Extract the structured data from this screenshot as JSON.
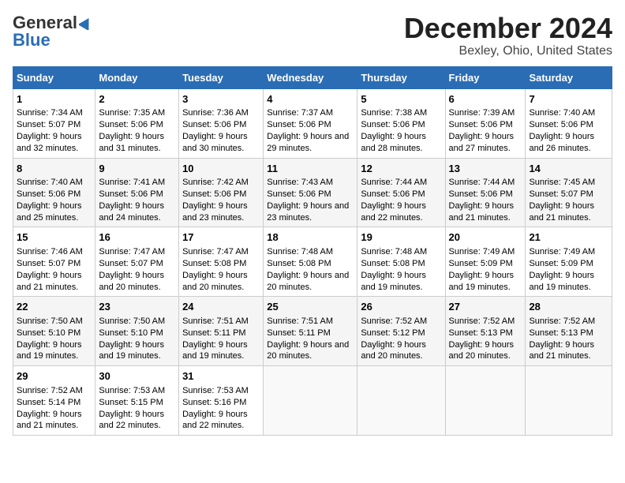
{
  "header": {
    "logo_general": "General",
    "logo_blue": "Blue",
    "title": "December 2024",
    "subtitle": "Bexley, Ohio, United States"
  },
  "days_of_week": [
    "Sunday",
    "Monday",
    "Tuesday",
    "Wednesday",
    "Thursday",
    "Friday",
    "Saturday"
  ],
  "weeks": [
    [
      {
        "day": "1",
        "sunrise": "Sunrise: 7:34 AM",
        "sunset": "Sunset: 5:07 PM",
        "daylight": "Daylight: 9 hours and 32 minutes."
      },
      {
        "day": "2",
        "sunrise": "Sunrise: 7:35 AM",
        "sunset": "Sunset: 5:06 PM",
        "daylight": "Daylight: 9 hours and 31 minutes."
      },
      {
        "day": "3",
        "sunrise": "Sunrise: 7:36 AM",
        "sunset": "Sunset: 5:06 PM",
        "daylight": "Daylight: 9 hours and 30 minutes."
      },
      {
        "day": "4",
        "sunrise": "Sunrise: 7:37 AM",
        "sunset": "Sunset: 5:06 PM",
        "daylight": "Daylight: 9 hours and 29 minutes."
      },
      {
        "day": "5",
        "sunrise": "Sunrise: 7:38 AM",
        "sunset": "Sunset: 5:06 PM",
        "daylight": "Daylight: 9 hours and 28 minutes."
      },
      {
        "day": "6",
        "sunrise": "Sunrise: 7:39 AM",
        "sunset": "Sunset: 5:06 PM",
        "daylight": "Daylight: 9 hours and 27 minutes."
      },
      {
        "day": "7",
        "sunrise": "Sunrise: 7:40 AM",
        "sunset": "Sunset: 5:06 PM",
        "daylight": "Daylight: 9 hours and 26 minutes."
      }
    ],
    [
      {
        "day": "8",
        "sunrise": "Sunrise: 7:40 AM",
        "sunset": "Sunset: 5:06 PM",
        "daylight": "Daylight: 9 hours and 25 minutes."
      },
      {
        "day": "9",
        "sunrise": "Sunrise: 7:41 AM",
        "sunset": "Sunset: 5:06 PM",
        "daylight": "Daylight: 9 hours and 24 minutes."
      },
      {
        "day": "10",
        "sunrise": "Sunrise: 7:42 AM",
        "sunset": "Sunset: 5:06 PM",
        "daylight": "Daylight: 9 hours and 23 minutes."
      },
      {
        "day": "11",
        "sunrise": "Sunrise: 7:43 AM",
        "sunset": "Sunset: 5:06 PM",
        "daylight": "Daylight: 9 hours and 23 minutes."
      },
      {
        "day": "12",
        "sunrise": "Sunrise: 7:44 AM",
        "sunset": "Sunset: 5:06 PM",
        "daylight": "Daylight: 9 hours and 22 minutes."
      },
      {
        "day": "13",
        "sunrise": "Sunrise: 7:44 AM",
        "sunset": "Sunset: 5:06 PM",
        "daylight": "Daylight: 9 hours and 21 minutes."
      },
      {
        "day": "14",
        "sunrise": "Sunrise: 7:45 AM",
        "sunset": "Sunset: 5:07 PM",
        "daylight": "Daylight: 9 hours and 21 minutes."
      }
    ],
    [
      {
        "day": "15",
        "sunrise": "Sunrise: 7:46 AM",
        "sunset": "Sunset: 5:07 PM",
        "daylight": "Daylight: 9 hours and 21 minutes."
      },
      {
        "day": "16",
        "sunrise": "Sunrise: 7:47 AM",
        "sunset": "Sunset: 5:07 PM",
        "daylight": "Daylight: 9 hours and 20 minutes."
      },
      {
        "day": "17",
        "sunrise": "Sunrise: 7:47 AM",
        "sunset": "Sunset: 5:08 PM",
        "daylight": "Daylight: 9 hours and 20 minutes."
      },
      {
        "day": "18",
        "sunrise": "Sunrise: 7:48 AM",
        "sunset": "Sunset: 5:08 PM",
        "daylight": "Daylight: 9 hours and 20 minutes."
      },
      {
        "day": "19",
        "sunrise": "Sunrise: 7:48 AM",
        "sunset": "Sunset: 5:08 PM",
        "daylight": "Daylight: 9 hours and 19 minutes."
      },
      {
        "day": "20",
        "sunrise": "Sunrise: 7:49 AM",
        "sunset": "Sunset: 5:09 PM",
        "daylight": "Daylight: 9 hours and 19 minutes."
      },
      {
        "day": "21",
        "sunrise": "Sunrise: 7:49 AM",
        "sunset": "Sunset: 5:09 PM",
        "daylight": "Daylight: 9 hours and 19 minutes."
      }
    ],
    [
      {
        "day": "22",
        "sunrise": "Sunrise: 7:50 AM",
        "sunset": "Sunset: 5:10 PM",
        "daylight": "Daylight: 9 hours and 19 minutes."
      },
      {
        "day": "23",
        "sunrise": "Sunrise: 7:50 AM",
        "sunset": "Sunset: 5:10 PM",
        "daylight": "Daylight: 9 hours and 19 minutes."
      },
      {
        "day": "24",
        "sunrise": "Sunrise: 7:51 AM",
        "sunset": "Sunset: 5:11 PM",
        "daylight": "Daylight: 9 hours and 19 minutes."
      },
      {
        "day": "25",
        "sunrise": "Sunrise: 7:51 AM",
        "sunset": "Sunset: 5:11 PM",
        "daylight": "Daylight: 9 hours and 20 minutes."
      },
      {
        "day": "26",
        "sunrise": "Sunrise: 7:52 AM",
        "sunset": "Sunset: 5:12 PM",
        "daylight": "Daylight: 9 hours and 20 minutes."
      },
      {
        "day": "27",
        "sunrise": "Sunrise: 7:52 AM",
        "sunset": "Sunset: 5:13 PM",
        "daylight": "Daylight: 9 hours and 20 minutes."
      },
      {
        "day": "28",
        "sunrise": "Sunrise: 7:52 AM",
        "sunset": "Sunset: 5:13 PM",
        "daylight": "Daylight: 9 hours and 21 minutes."
      }
    ],
    [
      {
        "day": "29",
        "sunrise": "Sunrise: 7:52 AM",
        "sunset": "Sunset: 5:14 PM",
        "daylight": "Daylight: 9 hours and 21 minutes."
      },
      {
        "day": "30",
        "sunrise": "Sunrise: 7:53 AM",
        "sunset": "Sunset: 5:15 PM",
        "daylight": "Daylight: 9 hours and 22 minutes."
      },
      {
        "day": "31",
        "sunrise": "Sunrise: 7:53 AM",
        "sunset": "Sunset: 5:16 PM",
        "daylight": "Daylight: 9 hours and 22 minutes."
      },
      null,
      null,
      null,
      null
    ]
  ]
}
